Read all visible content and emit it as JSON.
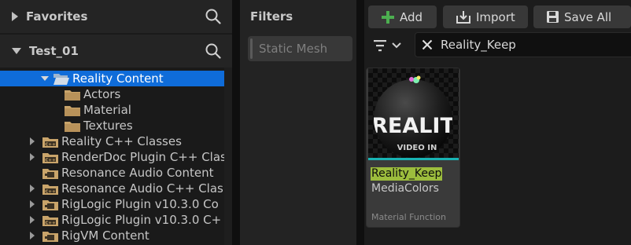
{
  "sources": {
    "favorites_label": "Favorites",
    "project_label": "Test_01",
    "tree": [
      {
        "label": "Reality Content",
        "indent": 1,
        "state": "expanded",
        "kind": "folder-open",
        "selected": true
      },
      {
        "label": "Actors",
        "indent": 2,
        "state": "none",
        "kind": "folder",
        "selected": false
      },
      {
        "label": "Material",
        "indent": 2,
        "state": "none",
        "kind": "folder",
        "selected": false
      },
      {
        "label": "Textures",
        "indent": 2,
        "state": "none",
        "kind": "folder",
        "selected": false
      },
      {
        "label": "Reality C++ Classes",
        "indent": 0,
        "state": "collapsed",
        "kind": "cpp",
        "selected": false
      },
      {
        "label": "RenderDoc Plugin C++ Clas",
        "indent": 0,
        "state": "collapsed",
        "kind": "cpp",
        "selected": false
      },
      {
        "label": "Resonance Audio Content",
        "indent": 0,
        "state": "none",
        "kind": "plugin",
        "selected": false
      },
      {
        "label": "Resonance Audio C++ Clas",
        "indent": 0,
        "state": "collapsed",
        "kind": "cpp",
        "selected": false
      },
      {
        "label": "RigLogic Plugin v10.3.0 Co",
        "indent": 0,
        "state": "collapsed",
        "kind": "plugin",
        "selected": false
      },
      {
        "label": "RigLogic Plugin v10.3.0 C+",
        "indent": 0,
        "state": "collapsed",
        "kind": "cpp",
        "selected": false
      },
      {
        "label": "RigVM Content",
        "indent": 0,
        "state": "collapsed",
        "kind": "plugin",
        "selected": false
      }
    ]
  },
  "filters": {
    "title": "Filters",
    "chip_label": "Static Mesh"
  },
  "toolbar": {
    "add_label": "Add",
    "import_label": "Import",
    "save_all_label": "Save All"
  },
  "search": {
    "value": "Reality_Keep"
  },
  "asset": {
    "name": "Reality_Keep",
    "path": "MediaColors",
    "type": "Material Function",
    "thumb_text": "REALIT",
    "thumb_subtext": "VIDEO IN"
  },
  "colors": {
    "selection": "#0f6cd9",
    "folder": "#c9a46a",
    "add_icon": "#4caf50",
    "highlight": "#9cbd3d",
    "type_bar": "#19b3b3"
  }
}
